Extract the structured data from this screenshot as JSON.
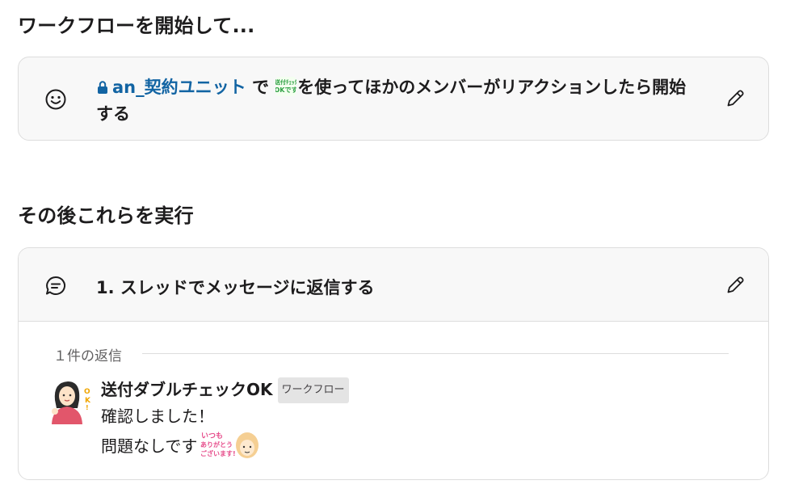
{
  "workflow": {
    "start_title": "ワークフローを開始して...",
    "trigger": {
      "channel": "an_契約ユニット",
      "text_before_emoji": " で ",
      "emoji_name": "送付チェックOKです",
      "text_after_emoji": "を使ってほかのメンバーがリアクションしたら開始する",
      "icon": "smiley-icon",
      "edit_icon": "pencil-icon"
    },
    "then_title": "その後これらを実行",
    "step": {
      "title": "1. スレッドでメッセージに返信する",
      "icon": "thread-reply-icon",
      "edit_icon": "pencil-icon",
      "replies_label": "１件の返信",
      "message": {
        "sender": "送付ダブルチェックOK",
        "badge": "ワークフロー",
        "line1": "確認しました！",
        "line2": "問題なしです",
        "emoji_name": "いつもありがとうございます"
      }
    }
  }
}
